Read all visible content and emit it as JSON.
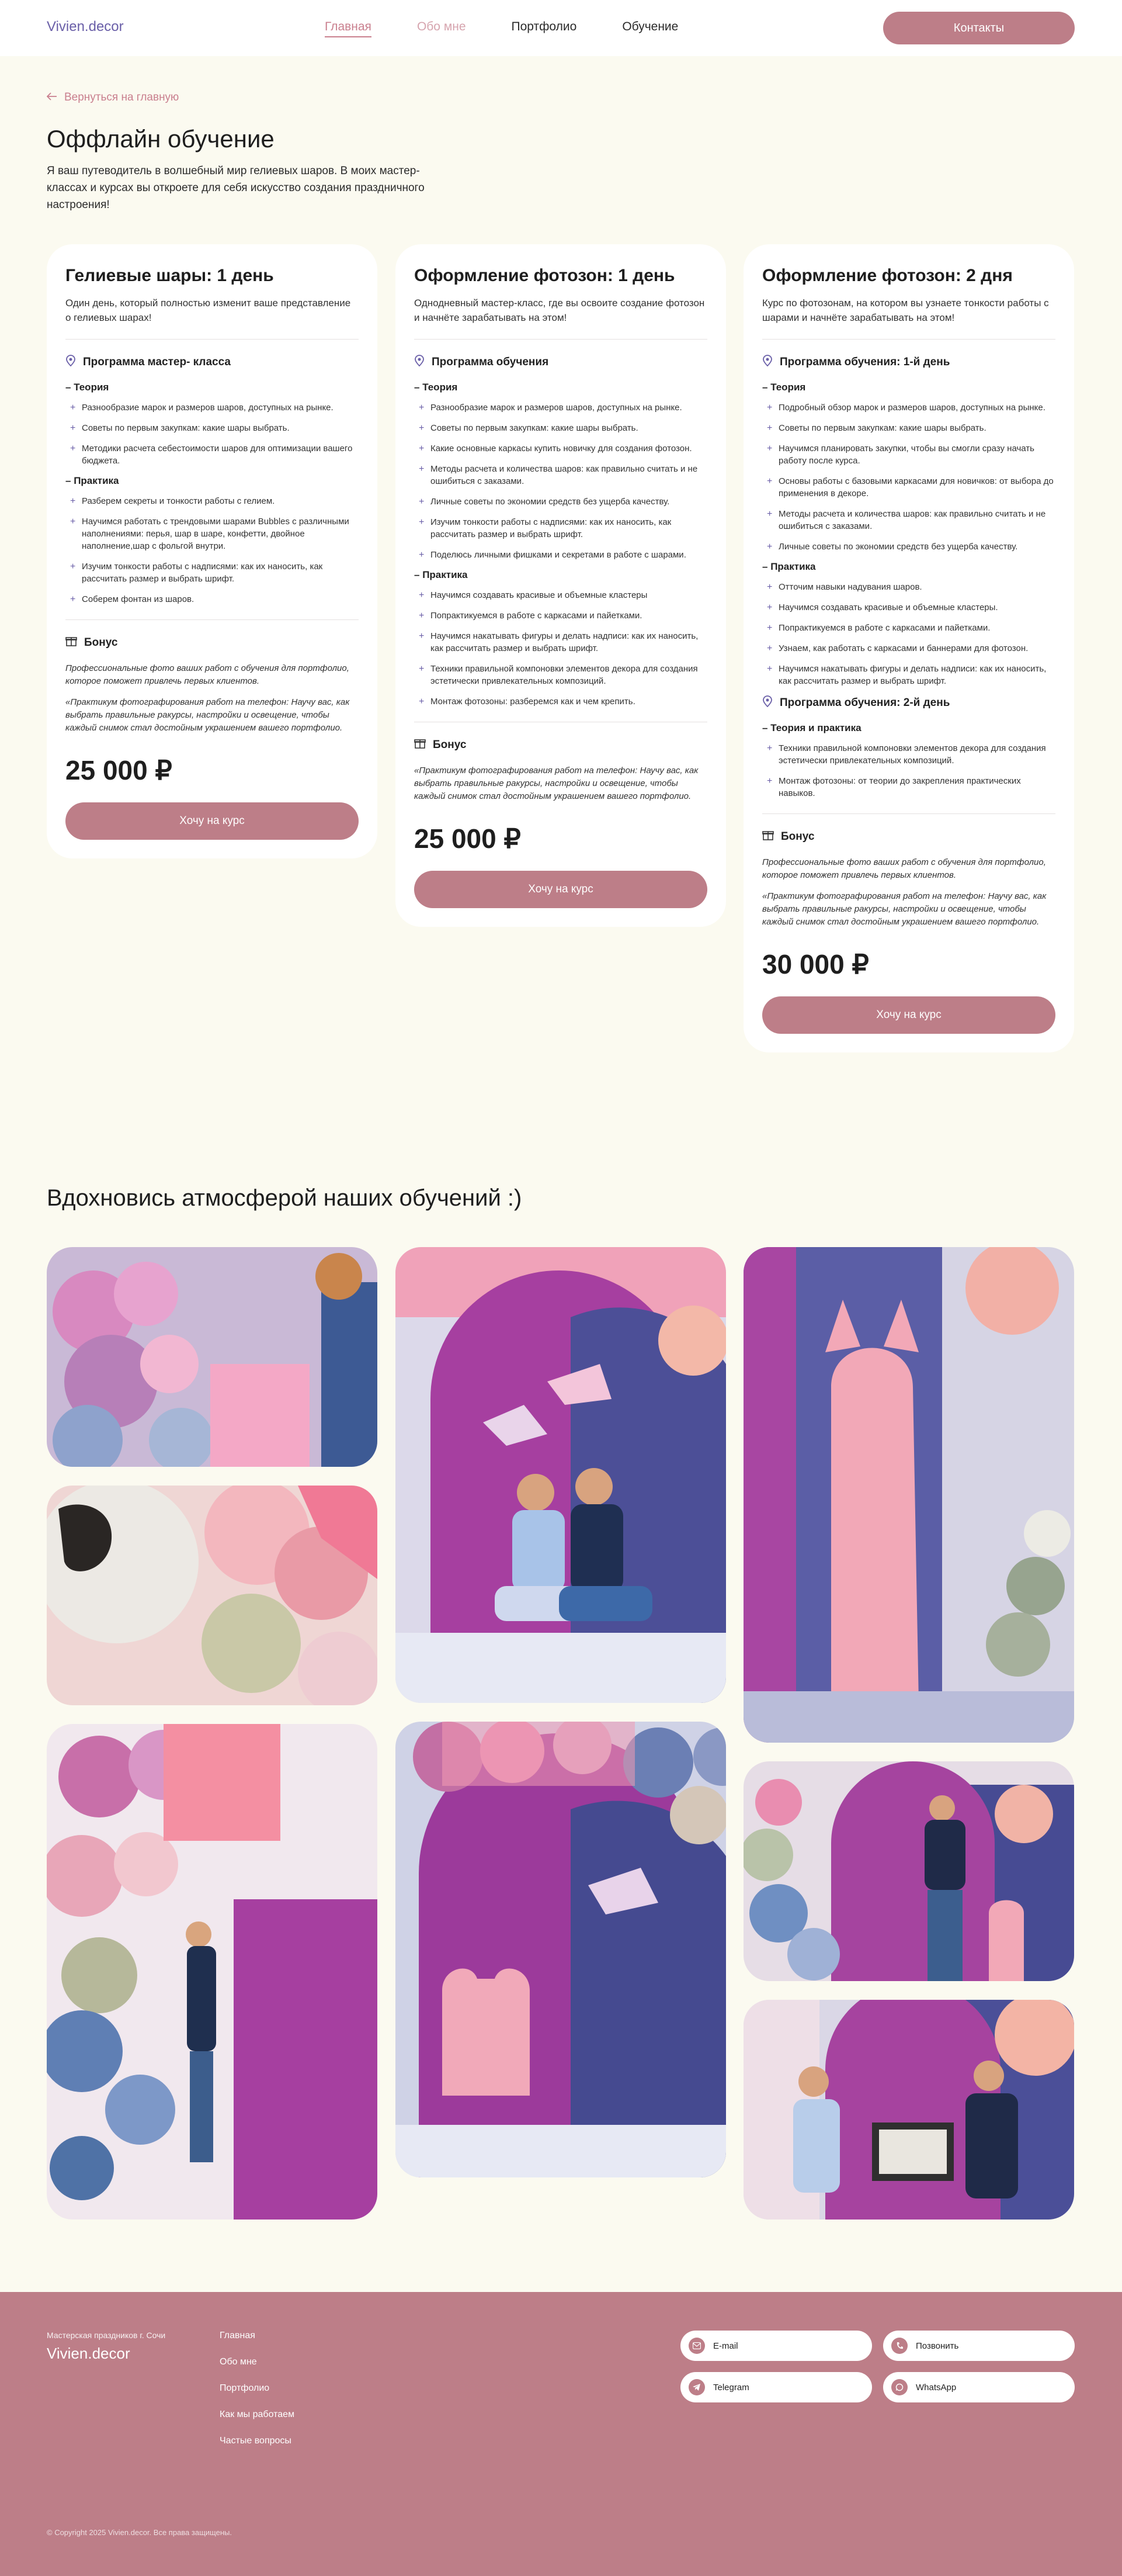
{
  "header": {
    "logo": "Vivien.decor",
    "nav": [
      "Главная",
      "Обо мне",
      "Портфолио",
      "Обучение"
    ],
    "contacts_button": "Контакты"
  },
  "intro": {
    "back_link": "Вернуться на главную",
    "title": "Оффлайн обучение",
    "text": "Я ваш путеводитель в волшебный мир гелиевых шаров. В моих мастер-классах и курсах вы откроете для себя искусство создания праздничного настроения!"
  },
  "courses": [
    {
      "title": "Гелиевые шары: 1 день",
      "desc": "Один день, который полностью изменит ваше представление о гелиевых шарах!",
      "program_title": "Программа мастер- класса",
      "theory_label": "Теория",
      "theory": [
        "Разнообразие марок и размеров шаров, доступных на рынке.",
        "Советы по первым закупкам: какие шары выбрать.",
        "Методики расчета себестоимости шаров для оптимизации вашего бюджета."
      ],
      "practice_label": "Практика",
      "practice": [
        "Разберем секреты и тонкости работы с гелием.",
        "Научимся работать с трендовыми шарами Bubbles с различными наполнениями: перья, шар в шаре, конфетти, двойное наполнение,шар с фольгой внутри.",
        "Изучим тонкости работы с надписями: как их наносить, как рассчитать размер и выбрать шрифт.",
        "Соберем фонтан из шаров."
      ],
      "bonus_label": "Бонус",
      "bonus": [
        "Профессиональные фото ваших работ с обучения для портфолио, которое поможет привлечь первых клиентов.",
        "«Практикум фотографирования работ на телефон: Научу вас, как выбрать правильные ракурсы, настройки и освещение, чтобы каждый снимок стал достойным украшением вашего портфолио."
      ],
      "price": "25 000 ₽",
      "cta": "Хочу на курс"
    },
    {
      "title": "Оформление фотозон: 1 день",
      "desc": "Однодневный мастер-класс, где вы освоите создание фотозон и начнёте зарабатывать на этом!",
      "program_title": "Программа обучения",
      "theory_label": "Теория",
      "theory": [
        "Разнообразие марок и размеров шаров, доступных на рынке.",
        "Советы по первым закупкам: какие шары выбрать.",
        "Какие основные каркасы купить новичку для создания фотозон.",
        "Методы расчета и количества шаров: как правильно считать и не ошибиться с заказами.",
        "Личные советы по экономии средств без ущерба качеству.",
        "Изучим тонкости работы с надписями: как их наносить, как рассчитать размер и выбрать шрифт.",
        "Поделюсь личными фишками и секретами в работе с шарами."
      ],
      "practice_label": "Практика",
      "practice": [
        "Научимся создавать красивые и объемные кластеры",
        "Попрактикуемся в работе с каркасами и пайетками.",
        "Научимся накатывать фигуры и делать надписи: как их наносить, как рассчитать размер и выбрать шрифт.",
        "Техники правильной компоновки элементов декора для создания эстетически привлекательных композиций.",
        "Монтаж фотозоны: разберемся как и чем крепить."
      ],
      "bonus_label": "Бонус",
      "bonus": [
        "«Практикум фотографирования работ на телефон: Научу вас, как выбрать правильные ракурсы, настройки и освещение, чтобы каждый снимок стал достойным украшением вашего портфолио."
      ],
      "price": "25 000 ₽",
      "cta": "Хочу на курс"
    },
    {
      "title": "Оформление фотозон: 2 дня",
      "desc": "Курс по фотозонам, на котором вы узнаете тонкости работы с шарами и начнёте зарабатывать на этом!",
      "program_title": "Программа обучения: 1-й день",
      "theory_label": "Теория",
      "theory": [
        "Подробный обзор марок и размеров шаров, доступных на рынке.",
        "Советы по первым закупкам: какие шары выбрать.",
        "Научимся планировать закупки, чтобы вы смогли сразу начать работу после курса.",
        "Основы работы с базовыми каркасами для новичков: от выбора до применения в декоре.",
        "Методы расчета и количества шаров: как правильно считать и не ошибиться с заказами.",
        "Личные советы по экономии средств без ущерба качеству."
      ],
      "practice_label": "Практика",
      "practice": [
        "Отточим навыки надувания шаров.",
        "Научимся создавать красивые и объемные кластеры.",
        "Попрактикуемся в работе с каркасами и пайетками.",
        "Узнаем, как работать с каркасами и баннерами для фотозон.",
        "Научимся накатывать фигуры и делать надписи: как их наносить, как рассчитать размер и выбрать шрифт."
      ],
      "program2_title": "Программа обучения: 2-й день",
      "tp_label": "Теория и практика",
      "tp": [
        "Техники правильной компоновки элементов декора для создания эстетически привлекательных композиций.",
        "Монтаж фотозоны: от теории до закрепления практических навыков."
      ],
      "bonus_label": "Бонус",
      "bonus": [
        "Профессиональные фото ваших работ с обучения для портфолио, которое поможет привлечь первых клиентов.",
        "«Практикум фотографирования работ на телефон: Научу вас, как выбрать правильные ракурсы, настройки и освещение, чтобы каждый снимок стал достойным украшением вашего портфолио."
      ],
      "price": "30 000 ₽",
      "cta": "Хочу на курс"
    }
  ],
  "gallery": {
    "title": "Вдохновись атмосферой наших обучений :)"
  },
  "footer": {
    "tagline": "Мастерская праздников г. Сочи",
    "logo": "Vivien.decor",
    "links": [
      "Главная",
      "Обо мне",
      "Портфолио",
      "Как мы работаем",
      "Частые вопросы"
    ],
    "contacts": [
      "E-mail",
      "Позвонить",
      "Telegram",
      "WhatsApp"
    ],
    "copyright": "© Copyright 2025 Vivien.decor. Все права защищены."
  },
  "colors": {
    "accent": "#bd7e88",
    "bg": "#fbfaf0",
    "icon": "#6a5fa8"
  }
}
